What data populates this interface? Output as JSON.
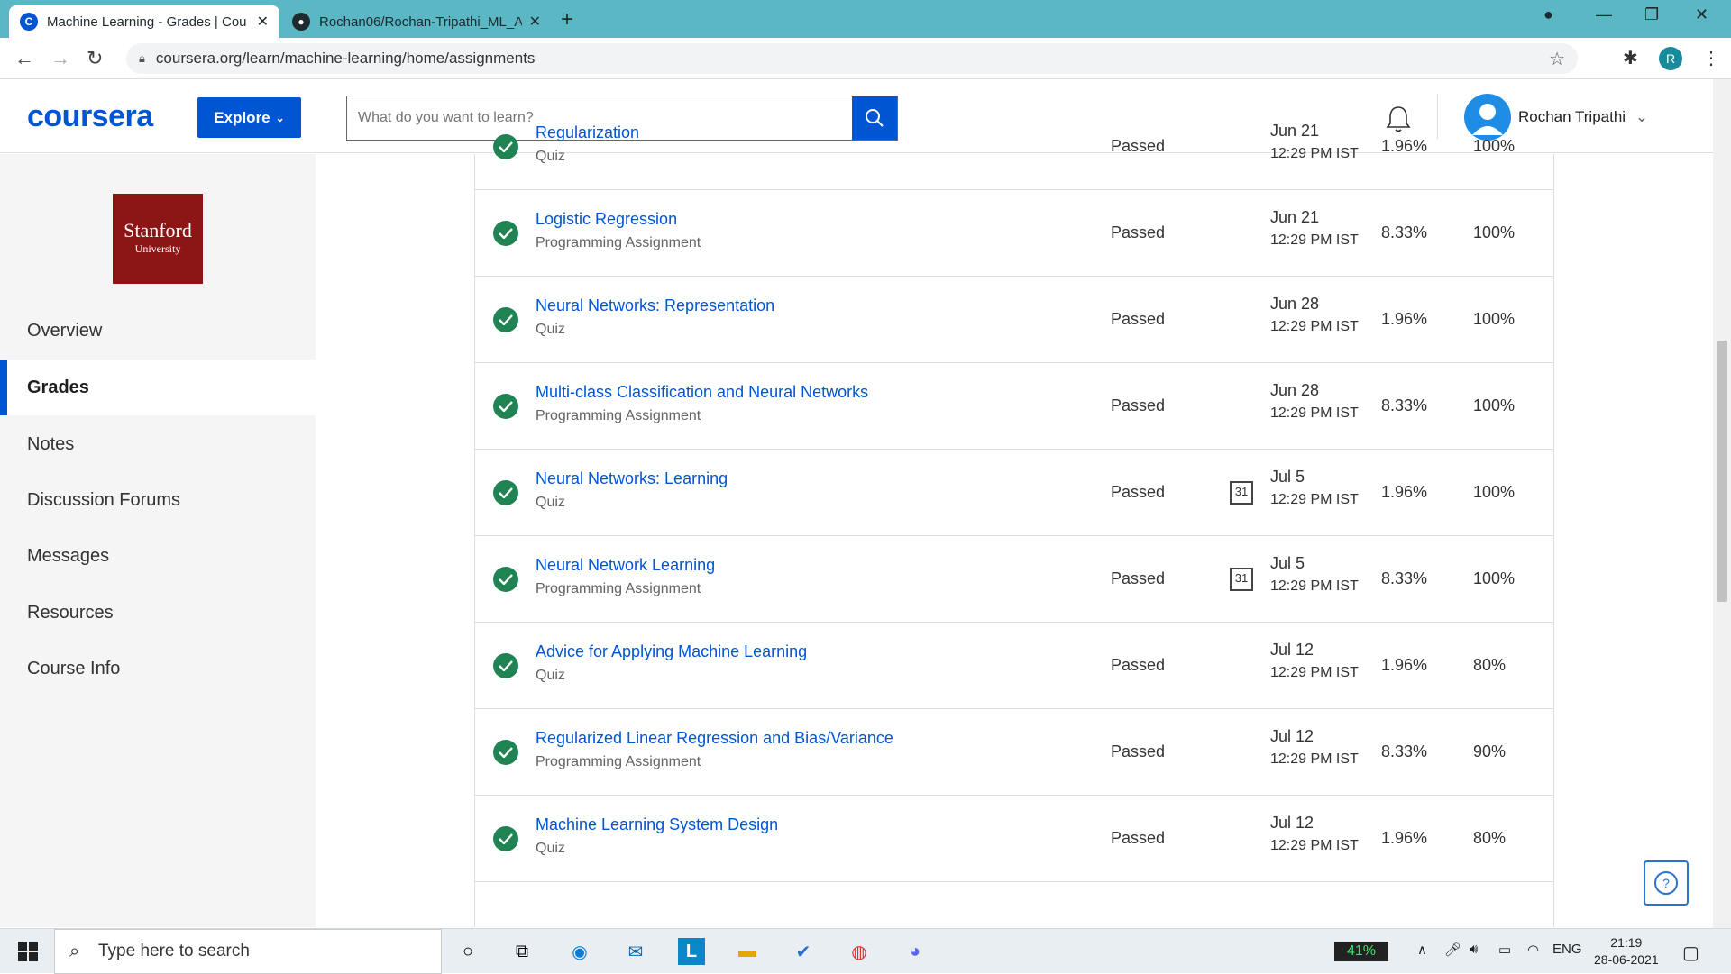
{
  "browser": {
    "tabs": [
      {
        "title": "Machine Learning - Grades | Cou",
        "active": true
      },
      {
        "title": "Rochan06/Rochan-Tripathi_ML_A",
        "active": false
      }
    ],
    "new_tab": "+",
    "url": "coursera.org/learn/machine-learning/home/assignments",
    "profile_initial": "R"
  },
  "header": {
    "logo": "coursera",
    "explore_label": "Explore",
    "search_placeholder": "What do you want to learn?",
    "user_name": "Rochan Tripathi"
  },
  "sidebar": {
    "university_line1": "Stanford",
    "university_line2": "University",
    "items": [
      {
        "label": "Overview",
        "active": false
      },
      {
        "label": "Grades",
        "active": true
      },
      {
        "label": "Notes",
        "active": false
      },
      {
        "label": "Discussion Forums",
        "active": false
      },
      {
        "label": "Messages",
        "active": false
      },
      {
        "label": "Resources",
        "active": false
      },
      {
        "label": "Course Info",
        "active": false
      }
    ]
  },
  "assignments": [
    {
      "name": "Regularization",
      "type": "Quiz",
      "status": "Passed",
      "date": "Jun 21",
      "time": "12:29 PM IST",
      "weight": "1.96%",
      "grade": "100%",
      "calendar": false
    },
    {
      "name": "Logistic Regression",
      "type": "Programming Assignment",
      "status": "Passed",
      "date": "Jun 21",
      "time": "12:29 PM IST",
      "weight": "8.33%",
      "grade": "100%",
      "calendar": false
    },
    {
      "name": "Neural Networks: Representation",
      "type": "Quiz",
      "status": "Passed",
      "date": "Jun 28",
      "time": "12:29 PM IST",
      "weight": "1.96%",
      "grade": "100%",
      "calendar": false
    },
    {
      "name": "Multi-class Classification and Neural Networks",
      "type": "Programming Assignment",
      "status": "Passed",
      "date": "Jun 28",
      "time": "12:29 PM IST",
      "weight": "8.33%",
      "grade": "100%",
      "calendar": false
    },
    {
      "name": "Neural Networks: Learning",
      "type": "Quiz",
      "status": "Passed",
      "date": "Jul 5",
      "time": "12:29 PM IST",
      "weight": "1.96%",
      "grade": "100%",
      "calendar": true,
      "calendar_day": "31"
    },
    {
      "name": "Neural Network Learning",
      "type": "Programming Assignment",
      "status": "Passed",
      "date": "Jul 5",
      "time": "12:29 PM IST",
      "weight": "8.33%",
      "grade": "100%",
      "calendar": true,
      "calendar_day": "31"
    },
    {
      "name": "Advice for Applying Machine Learning",
      "type": "Quiz",
      "status": "Passed",
      "date": "Jul 12",
      "time": "12:29 PM IST",
      "weight": "1.96%",
      "grade": "80%",
      "calendar": false
    },
    {
      "name": "Regularized Linear Regression and Bias/Variance",
      "type": "Programming Assignment",
      "status": "Passed",
      "date": "Jul 12",
      "time": "12:29 PM IST",
      "weight": "8.33%",
      "grade": "90%",
      "calendar": false
    },
    {
      "name": "Machine Learning System Design",
      "type": "Quiz",
      "status": "Passed",
      "date": "Jul 12",
      "time": "12:29 PM IST",
      "weight": "1.96%",
      "grade": "80%",
      "calendar": false
    }
  ],
  "help_label": "?",
  "taskbar": {
    "search_placeholder": "Type here to search",
    "battery": "41%",
    "language": "ENG",
    "time": "21:19",
    "date": "28-06-2021"
  },
  "colors": {
    "tabbar": "#5bb7c3",
    "brand": "#0056d2",
    "passed_check": "#1f8354",
    "stanford": "#8c1515"
  }
}
